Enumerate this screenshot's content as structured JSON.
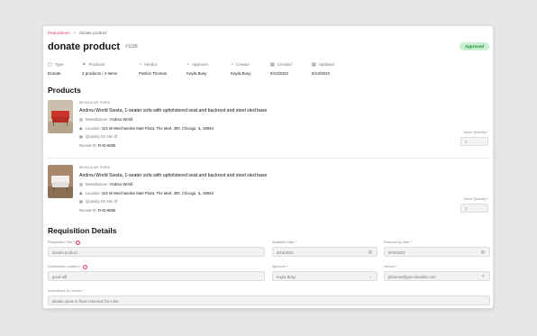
{
  "breadcrumb": {
    "parent": "Requisitions",
    "separator": ">",
    "current": "donate product"
  },
  "header": {
    "title": "donate product",
    "id": "#1188",
    "status": "Approved",
    "status_color": "#1f8a3b"
  },
  "meta": [
    {
      "icon": "tag-icon",
      "glyph": "▢",
      "label": "Type",
      "value": "Donate"
    },
    {
      "icon": "products-icon",
      "glyph": "⚘",
      "label": "Products",
      "value": "2 products / 4 items"
    },
    {
      "icon": "vendor-icon",
      "glyph": "◔",
      "label": "Vendor",
      "value": "Patrick Thomas"
    },
    {
      "icon": "approver-icon",
      "glyph": "◔",
      "label": "Approver",
      "value": "Kayla Busy"
    },
    {
      "icon": "creator-icon",
      "glyph": "◔",
      "label": "Creator",
      "value": "Kayla Busy"
    },
    {
      "icon": "calendar-icon",
      "glyph": "▤",
      "label": "Created",
      "value": "8/13/2022"
    },
    {
      "icon": "calendar-icon",
      "glyph": "▤",
      "label": "Updated",
      "value": "8/13/2022"
    }
  ],
  "products_heading": "Products",
  "products": [
    {
      "category": "MODULAR SOFA",
      "name": "Andreu World Siesta, 1-seater sofa with upholstered seat and backrest and steel sled base",
      "manufacturer_label": "Manufacturer:",
      "manufacturer": "Andreu World",
      "location_label": "Location:",
      "location": "222 W Merchandise Mart Plaza, The Mart, 390, Chicago, IL, 60654",
      "qty_label": "Quantity On site:",
      "qty": "0",
      "reesat_label": "Reesat ID:",
      "reesat_id": "R-ID-5996",
      "move_qty_label": "Move Quantity *",
      "move_qty": "2",
      "accent": "#c9352b"
    },
    {
      "category": "MODULAR SOFA",
      "name": "Andreu World Siesta, 1-seater sofa with upholstered seat and backrest and steel sled base",
      "manufacturer_label": "Manufacturer:",
      "manufacturer": "Andreu World",
      "location_label": "Location:",
      "location": "222 W Merchandise Mart Plaza, The Mart, 390, Chicago, IL, 60654",
      "qty_label": "Quantity On site:",
      "qty": "0",
      "reesat_label": "Reesat ID:",
      "reesat_id": "R-ID-5995",
      "move_qty_label": "Move Quantity *",
      "move_qty": "2",
      "accent": "#e8e6e2"
    }
  ],
  "details_heading": "Requisition Details",
  "form": {
    "req_title_label": "Requisition Title *",
    "req_title_value": "donate product",
    "available_date_label": "Available Date *",
    "available_date_value": "8/16/2022",
    "removal_date_label": "Removal by date *",
    "removal_date_value": "8/20/2022",
    "destination_label": "Destination Location *",
    "destination_value": "good will",
    "approver_label": "Approver *",
    "approver_value": "Kayla Busy",
    "vendor_label": "Vendor *",
    "vendor_value": "pthomas@greenbuilder.com",
    "instructions_label": "Instructions for vendor *",
    "instructions_value": "please quote to have removed from site"
  }
}
